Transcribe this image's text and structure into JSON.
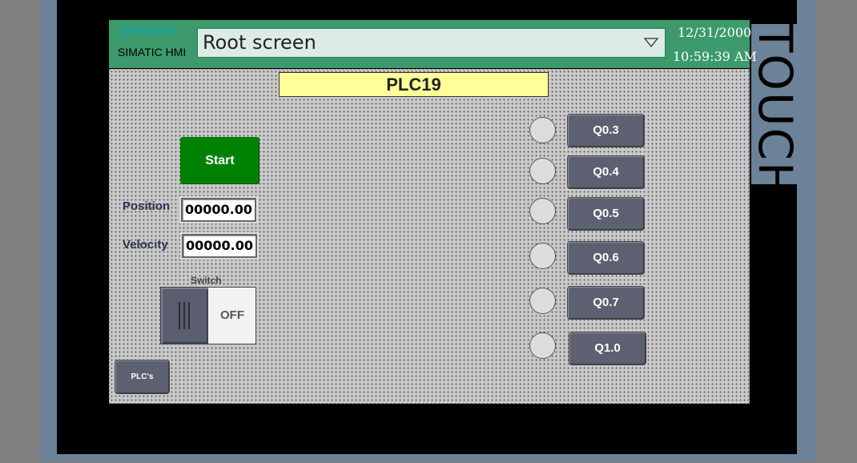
{
  "device": {
    "side_label": "TOUCH"
  },
  "header": {
    "brand": "SIEMENS",
    "product": "SIMATIC HMI",
    "screen_select": "Root screen",
    "date": "12/31/2000",
    "time": "10:59:39 AM",
    "colors": {
      "header_bg": "#3c9a6c",
      "brand": "#1ba0a0"
    }
  },
  "screen": {
    "title": "PLC19",
    "start_label": "Start",
    "position_label": "Position",
    "position_value": "00000.00",
    "velocity_label": "Velocity",
    "velocity_value": "00000.00",
    "switch_label": "Switch",
    "switch_state": "OFF",
    "plcs_label": "PLC's",
    "outputs": [
      {
        "label": "Q0.3"
      },
      {
        "label": "Q0.4"
      },
      {
        "label": "Q0.5"
      },
      {
        "label": "Q0.6"
      },
      {
        "label": "Q0.7"
      },
      {
        "label": "Q1.0"
      }
    ],
    "colors": {
      "start": "#008000",
      "title_bg": "#ffff99",
      "button": "#5d6070"
    }
  }
}
